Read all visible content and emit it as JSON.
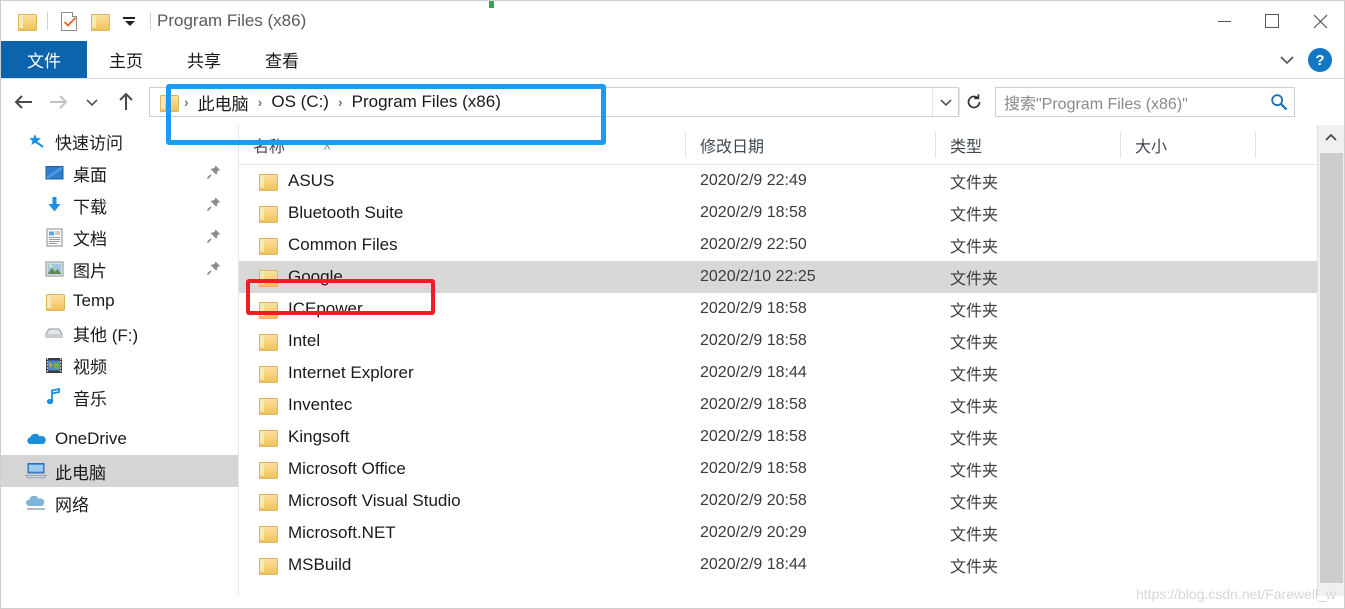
{
  "window": {
    "title": "Program Files (x86)",
    "controls": {
      "minimize": "—",
      "maximize": "□",
      "close": "✕"
    }
  },
  "quick_access_toolbar": {
    "items": [
      {
        "name": "folder-icon",
        "label": ""
      },
      {
        "name": "properties-icon",
        "label": ""
      },
      {
        "name": "new-folder-icon",
        "label": ""
      },
      {
        "name": "customize-qat-caret",
        "label": ""
      }
    ]
  },
  "ribbon": {
    "tabs": [
      {
        "id": "file",
        "label": "文件",
        "active": true
      },
      {
        "id": "home",
        "label": "主页",
        "active": false
      },
      {
        "id": "share",
        "label": "共享",
        "active": false
      },
      {
        "id": "view",
        "label": "查看",
        "active": false
      }
    ],
    "collapse_icon": "chevron-down-icon",
    "help_label": "?"
  },
  "navigation": {
    "back_icon": "arrow-left-icon",
    "forward_icon": "arrow-right-icon",
    "recent_icon": "chevron-down-icon",
    "up_icon": "arrow-up-icon",
    "breadcrumb": [
      "此电脑",
      "OS (C:)",
      "Program Files (x86)"
    ],
    "breadcrumb_separator": "›",
    "dropdown_icon": "chevron-down-icon",
    "refresh_icon": "refresh-icon"
  },
  "search": {
    "placeholder": "搜索\"Program Files (x86)\"",
    "value": "",
    "icon": "search-icon"
  },
  "sidebar": {
    "items": [
      {
        "label": "快速访问",
        "icon": "star-pin-icon",
        "level": 1,
        "pinned": false,
        "selected": false
      },
      {
        "label": "桌面",
        "icon": "desktop-icon",
        "level": 2,
        "pinned": true,
        "selected": false
      },
      {
        "label": "下载",
        "icon": "download-icon",
        "level": 2,
        "pinned": true,
        "selected": false
      },
      {
        "label": "文档",
        "icon": "documents-icon",
        "level": 2,
        "pinned": true,
        "selected": false
      },
      {
        "label": "图片",
        "icon": "pictures-icon",
        "level": 2,
        "pinned": true,
        "selected": false
      },
      {
        "label": "Temp",
        "icon": "folder-icon",
        "level": 2,
        "pinned": false,
        "selected": false
      },
      {
        "label": "其他 (F:)",
        "icon": "drive-icon",
        "level": 2,
        "pinned": false,
        "selected": false
      },
      {
        "label": "视频",
        "icon": "videos-icon",
        "level": 2,
        "pinned": false,
        "selected": false
      },
      {
        "label": "音乐",
        "icon": "music-icon",
        "level": 2,
        "pinned": false,
        "selected": false
      },
      {
        "label": "OneDrive",
        "icon": "onedrive-cloud-icon",
        "level": 1,
        "pinned": false,
        "selected": false
      },
      {
        "label": "此电脑",
        "icon": "this-pc-icon",
        "level": 1,
        "pinned": false,
        "selected": true
      },
      {
        "label": "网络",
        "icon": "network-icon",
        "level": 1,
        "pinned": false,
        "selected": false
      }
    ]
  },
  "file_list": {
    "columns": [
      {
        "id": "name",
        "label": "名称"
      },
      {
        "id": "date",
        "label": "修改日期"
      },
      {
        "id": "type",
        "label": "类型"
      },
      {
        "id": "size",
        "label": "大小"
      }
    ],
    "rows": [
      {
        "name": "ASUS",
        "date": "2020/2/9 22:49",
        "type": "文件夹",
        "size": "",
        "selected": false
      },
      {
        "name": "Bluetooth Suite",
        "date": "2020/2/9 18:58",
        "type": "文件夹",
        "size": "",
        "selected": false
      },
      {
        "name": "Common Files",
        "date": "2020/2/9 22:50",
        "type": "文件夹",
        "size": "",
        "selected": false
      },
      {
        "name": "Google",
        "date": "2020/2/10 22:25",
        "type": "文件夹",
        "size": "",
        "selected": true
      },
      {
        "name": "ICEpower",
        "date": "2020/2/9 18:58",
        "type": "文件夹",
        "size": "",
        "selected": false
      },
      {
        "name": "Intel",
        "date": "2020/2/9 18:58",
        "type": "文件夹",
        "size": "",
        "selected": false
      },
      {
        "name": "Internet Explorer",
        "date": "2020/2/9 18:44",
        "type": "文件夹",
        "size": "",
        "selected": false
      },
      {
        "name": "Inventec",
        "date": "2020/2/9 18:58",
        "type": "文件夹",
        "size": "",
        "selected": false
      },
      {
        "name": "Kingsoft",
        "date": "2020/2/9 18:58",
        "type": "文件夹",
        "size": "",
        "selected": false
      },
      {
        "name": "Microsoft Office",
        "date": "2020/2/9 18:58",
        "type": "文件夹",
        "size": "",
        "selected": false
      },
      {
        "name": "Microsoft Visual Studio",
        "date": "2020/2/9 20:58",
        "type": "文件夹",
        "size": "",
        "selected": false
      },
      {
        "name": "Microsoft.NET",
        "date": "2020/2/9 20:29",
        "type": "文件夹",
        "size": "",
        "selected": false
      },
      {
        "name": "MSBuild",
        "date": "2020/2/9 18:44",
        "type": "文件夹",
        "size": "",
        "selected": false
      }
    ]
  },
  "annotations": {
    "blue_box_color": "#1d9bf0",
    "red_box_color": "#ee1c25",
    "blue_box_target": "address-bar-breadcrumb",
    "red_box_target": "google-folder-row"
  },
  "watermark": {
    "text": "https://blog.csdn.net/Farewell_w"
  },
  "colors": {
    "file_tab_blue": "#0c64ac",
    "selection_gray": "#d8d8d8",
    "sidebar_selection_gray": "#d5d5d5",
    "folder_yellow": "#f6d076",
    "help_blue": "#1277c4"
  }
}
